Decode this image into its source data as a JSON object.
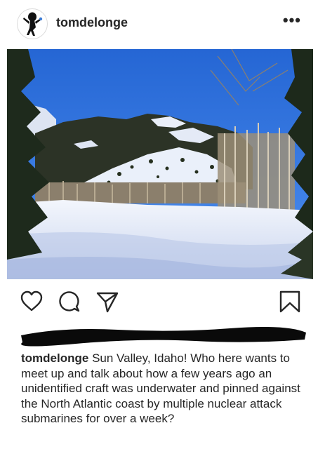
{
  "post": {
    "username": "tomdelonge",
    "more_label": "•••",
    "avatar": "avatar-illustration",
    "photo": "snowy-mountain-landscape",
    "caption_username": "tomdelonge",
    "caption_text": " Sun Valley, Idaho! Who here wants to meet up and talk about how a few years ago an unidentified craft was underwater and pinned against the North Atlantic coast by multiple nuclear attack submarines for over a week?"
  },
  "icons": {
    "like": "heart-icon",
    "comment": "comment-bubble-icon",
    "share": "paper-plane-icon",
    "save": "bookmark-icon"
  },
  "colors": {
    "text": "#262626",
    "sky": "#2b6fd6",
    "snow": "#eef2fb"
  }
}
